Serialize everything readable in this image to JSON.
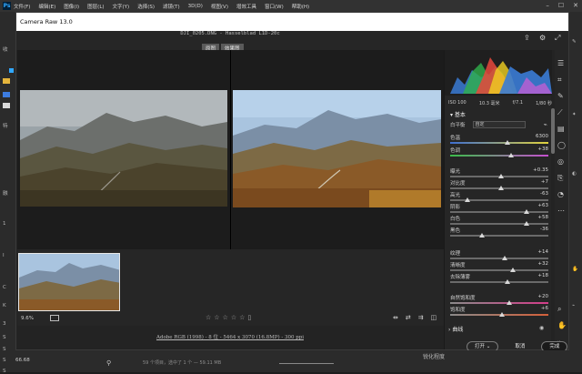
{
  "ps": {
    "logo": "Ps",
    "menus": [
      "文件(F)",
      "编辑(E)",
      "图像(I)",
      "图层(L)",
      "文字(Y)",
      "选择(S)",
      "滤镜(T)",
      "3D(D)",
      "视图(V)",
      "增效工具",
      "窗口(W)",
      "帮助(H)"
    ],
    "left_strip": [
      "收",
      "特",
      "融",
      "1",
      "I",
      "C",
      "K",
      "3",
      "S",
      "S",
      "S",
      "S"
    ],
    "status_text": "59 个项目，选中了 1 个 — 59.11 MB",
    "right_panel_title": "锐化程度",
    "bottom_zoom": "66.68"
  },
  "acr": {
    "title": "Camera Raw 13.0",
    "file_title": "DJI_0205.DNG - Hasselblad L1D-20c",
    "view_buttons": [
      "原图",
      "效果图"
    ],
    "zoom": "9.6%",
    "stars": [
      "☆",
      "☆",
      "☆",
      "☆",
      "☆"
    ],
    "file_info": "Adobe RGB (1998) - 8 位 - 5464 x 3070 (16.8MP) - 300 ppi",
    "exif": [
      "ISO 100",
      "10.3 毫米",
      "f/7.1",
      "1/80 秒"
    ],
    "panel_title": "基本",
    "wb_label": "白平衡",
    "wb_value": "自定",
    "sliders": [
      {
        "label": "色温",
        "value": "6300",
        "pos": 0.58
      },
      {
        "label": "色调",
        "value": "+38",
        "pos": 0.62
      },
      {
        "label": "曝光",
        "value": "+0.35",
        "pos": 0.52
      },
      {
        "label": "对比度",
        "value": "+7",
        "pos": 0.52
      },
      {
        "label": "高光",
        "value": "-63",
        "pos": 0.18
      },
      {
        "label": "阴影",
        "value": "+63",
        "pos": 0.78
      },
      {
        "label": "白色",
        "value": "+58",
        "pos": 0.78
      },
      {
        "label": "黑色",
        "value": "-36",
        "pos": 0.32
      },
      {
        "label": "纹理",
        "value": "+14",
        "pos": 0.56
      },
      {
        "label": "清晰度",
        "value": "+32",
        "pos": 0.64
      },
      {
        "label": "去除薄雾",
        "value": "+18",
        "pos": 0.58
      },
      {
        "label": "自然饱和度",
        "value": "+20",
        "pos": 0.6
      },
      {
        "label": "饱和度",
        "value": "+6",
        "pos": 0.53
      }
    ],
    "curve_label": "曲线",
    "buttons": {
      "open": "打开",
      "cancel": "取消",
      "done": "完成"
    }
  },
  "colors": {
    "accent": "#31a8ff",
    "panel": "#262626"
  }
}
